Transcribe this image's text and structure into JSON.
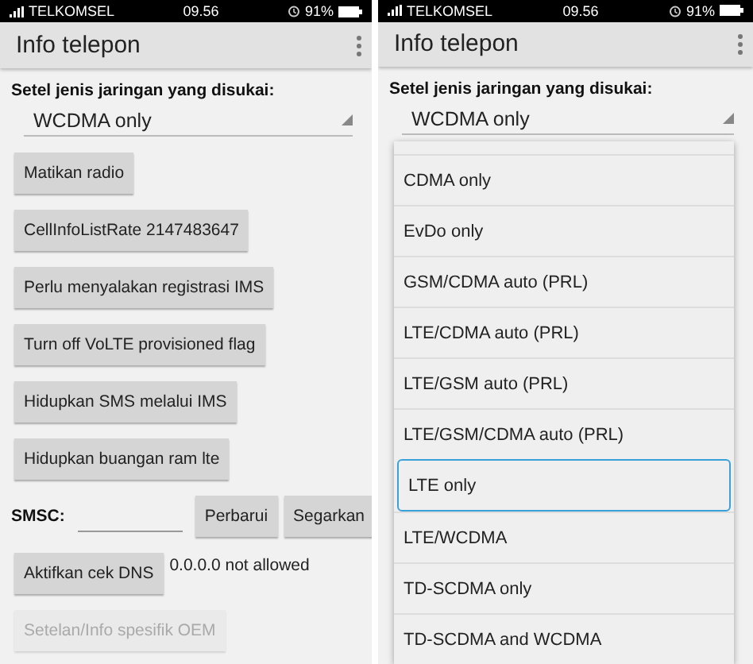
{
  "screens": [
    {
      "status_bar": {
        "carrier": "TELKOMSEL",
        "time": "09.56",
        "battery": "91%"
      },
      "app_bar": {
        "title": "Info telepon"
      },
      "network_label": "Setel jenis jaringan yang disukai:",
      "network_spinner": {
        "value": "WCDMA only"
      },
      "controls": [
        {
          "kind": "button",
          "label": "Matikan radio",
          "disabled": false
        },
        {
          "kind": "button",
          "label": "CellInfoListRate 2147483647",
          "disabled": false
        },
        {
          "kind": "button",
          "label": "Perlu menyalakan registrasi IMS",
          "disabled": false
        },
        {
          "kind": "button",
          "label": "Turn off VoLTE provisioned flag",
          "disabled": false
        },
        {
          "kind": "button",
          "label": "Hidupkan SMS melalui IMS",
          "disabled": false
        },
        {
          "kind": "button",
          "label": "Hidupkan buangan ram lte",
          "disabled": false
        },
        {
          "kind": "smsc",
          "label": "SMSC:",
          "buttons": [
            "Perbarui",
            "Segarkan"
          ]
        },
        {
          "kind": "button_note",
          "label": "Aktifkan cek DNS",
          "note": "0.0.0.0 not allowed",
          "disabled": false
        },
        {
          "kind": "button",
          "label": "Setelan/Info spesifik OEM",
          "disabled": true
        }
      ]
    },
    {
      "status_bar": {
        "carrier": "TELKOMSEL",
        "time": "09.56",
        "battery": "91%"
      },
      "app_bar": {
        "title": "Info telepon"
      },
      "network_label": "Setel jenis jaringan yang disukai:",
      "network_spinner": {
        "value": "WCDMA only"
      },
      "dropdown": [
        {
          "label": "CDMA only",
          "selected": false
        },
        {
          "label": "EvDo only",
          "selected": false
        },
        {
          "label": "GSM/CDMA auto (PRL)",
          "selected": false
        },
        {
          "label": "LTE/CDMA auto (PRL)",
          "selected": false
        },
        {
          "label": "LTE/GSM auto (PRL)",
          "selected": false
        },
        {
          "label": "LTE/GSM/CDMA auto (PRL)",
          "selected": false
        },
        {
          "label": "LTE only",
          "selected": true
        },
        {
          "label": "LTE/WCDMA",
          "selected": false
        },
        {
          "label": "TD-SCDMA only",
          "selected": false
        },
        {
          "label": "TD-SCDMA and WCDMA",
          "selected": false
        }
      ]
    }
  ]
}
